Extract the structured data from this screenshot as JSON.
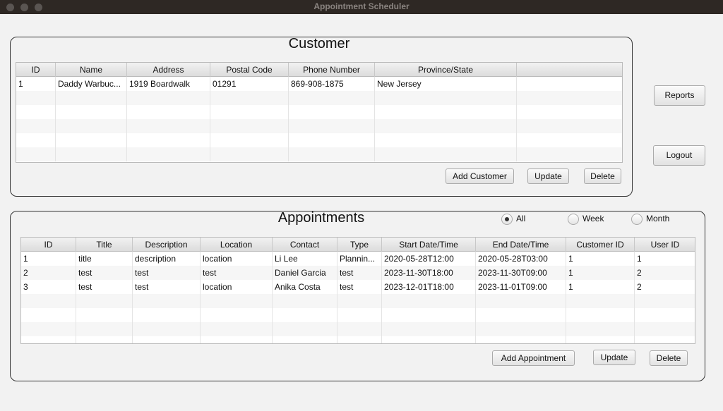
{
  "window": {
    "title": "Appointment Scheduler"
  },
  "customer": {
    "title": "Customer",
    "columns": [
      "ID",
      "Name",
      "Address",
      "Postal Code",
      "Phone Number",
      "Province/State",
      ""
    ],
    "rows": [
      [
        "1",
        "Daddy Warbuc...",
        "1919 Boardwalk",
        "01291",
        "869-908-1875",
        "New Jersey",
        ""
      ]
    ],
    "add_label": "Add Customer",
    "update_label": "Update",
    "delete_label": "Delete"
  },
  "side": {
    "reports_label": "Reports",
    "logout_label": "Logout"
  },
  "appointments": {
    "title": "Appointments",
    "filters": [
      {
        "label": "All",
        "selected": true
      },
      {
        "label": "Week",
        "selected": false
      },
      {
        "label": "Month",
        "selected": false
      }
    ],
    "columns": [
      "ID",
      "Title",
      "Description",
      "Location",
      "Contact",
      "Type",
      "Start Date/Time",
      "End Date/Time",
      "Customer ID",
      "User ID"
    ],
    "rows": [
      [
        "1",
        "title",
        "description",
        "location",
        "Li Lee",
        "Plannin...",
        "2020-05-28T12:00",
        "2020-05-28T03:00",
        "1",
        "1"
      ],
      [
        "2",
        "test",
        "test",
        "test",
        "Daniel Garcia",
        "test",
        "2023-11-30T18:00",
        "2023-11-30T09:00",
        "1",
        "2"
      ],
      [
        "3",
        "test",
        "test",
        "location",
        "Anika Costa",
        "test",
        "2023-12-01T18:00",
        "2023-11-01T09:00",
        "1",
        "2"
      ]
    ],
    "add_label": "Add Appointment",
    "update_label": "Update",
    "delete_label": "Delete"
  }
}
